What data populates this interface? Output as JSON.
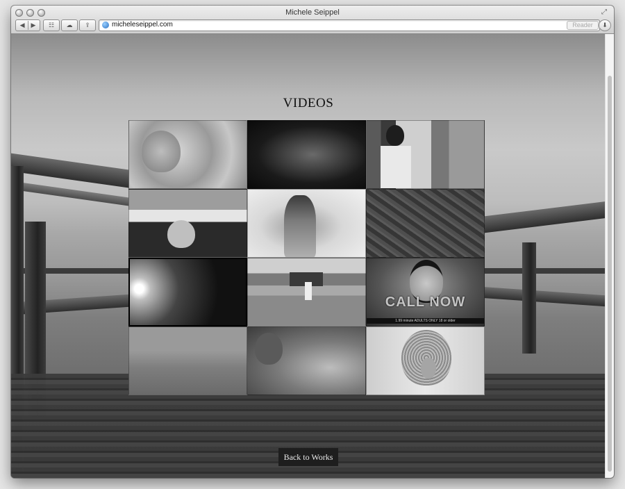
{
  "window": {
    "title": "Michele Seippel"
  },
  "toolbar": {
    "url": "micheleseippel.com",
    "reader_label": "Reader"
  },
  "page": {
    "title": "VIDEOS",
    "back_label": "Back to Works"
  },
  "thumbnails": [
    {
      "overlay": ""
    },
    {
      "overlay": ""
    },
    {
      "overlay": ""
    },
    {
      "overlay": ""
    },
    {
      "overlay": ""
    },
    {
      "overlay": ""
    },
    {
      "overlay": ""
    },
    {
      "overlay": ""
    },
    {
      "overlay": "CALL NOW",
      "sub": "1.99 minute ADULTS ONLY 18 or older"
    },
    {
      "overlay": ""
    },
    {
      "overlay": ""
    },
    {
      "overlay": ""
    }
  ]
}
